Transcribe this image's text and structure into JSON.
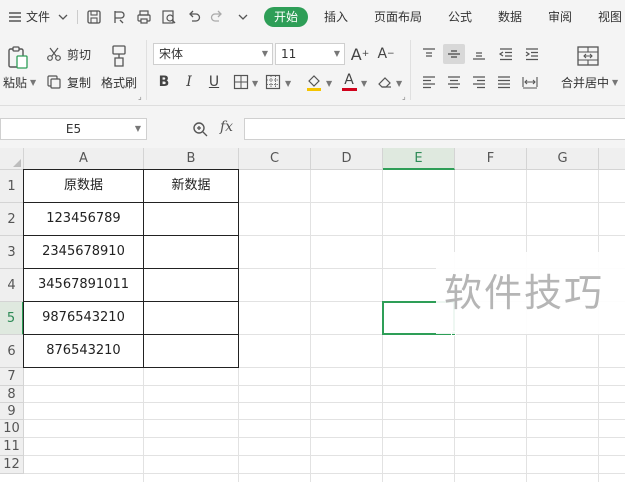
{
  "menu": {
    "file_label": "文件",
    "tabs": [
      {
        "label": "开始",
        "active": true
      },
      {
        "label": "插入"
      },
      {
        "label": "页面布局"
      },
      {
        "label": "公式"
      },
      {
        "label": "数据"
      },
      {
        "label": "审阅"
      },
      {
        "label": "视图"
      }
    ]
  },
  "ribbon": {
    "paste_label": "粘贴",
    "cut_label": "剪切",
    "copy_label": "复制",
    "format_painter_label": "格式刷",
    "font_name": "宋体",
    "font_size": "11",
    "merge_label": "合并居中",
    "accent_color": "#2e9e57",
    "font_color": "#d0021b",
    "fill_color": "#f5c400"
  },
  "formula_bar": {
    "name_box": "E5",
    "fx_label": "fx",
    "formula": ""
  },
  "sheet": {
    "columns": [
      "A",
      "B",
      "C",
      "D",
      "E",
      "F",
      "G"
    ],
    "rows": [
      "1",
      "2",
      "3",
      "4",
      "5",
      "6",
      "7",
      "8",
      "9",
      "10",
      "11",
      "12"
    ],
    "active_column": "E",
    "active_row": "5",
    "header_a": "原数据",
    "header_b": "新数据",
    "values_a": [
      "123456789",
      "2345678910",
      "34567891011",
      "9876543210",
      "876543210"
    ]
  },
  "watermark": "软件技巧"
}
